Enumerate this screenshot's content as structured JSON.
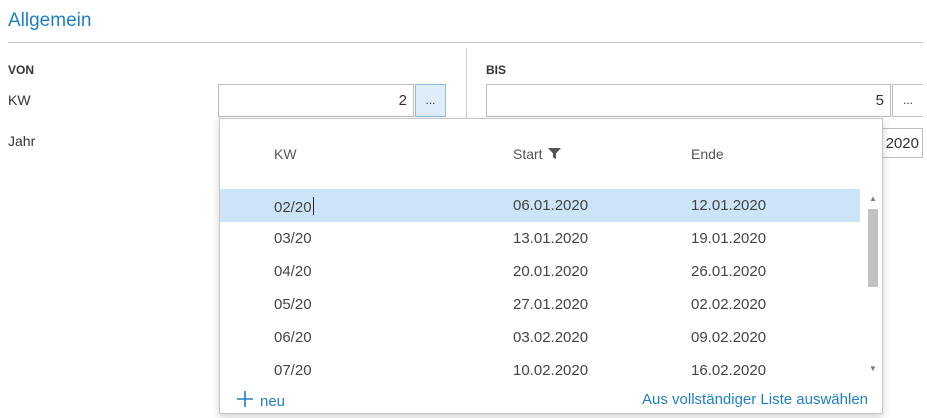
{
  "section": {
    "title": "Allgemein"
  },
  "from": {
    "header": "VON",
    "week_label": "KW",
    "week_value": "2",
    "year_label": "Jahr",
    "lookup_label": "..."
  },
  "to": {
    "header": "BIS",
    "week_value": "5",
    "year_value": "2020",
    "lookup_label": "..."
  },
  "dropdown": {
    "columns": {
      "kw": "KW",
      "start": "Start",
      "end": "Ende"
    },
    "rows": [
      {
        "kw": "02/20",
        "start": "06.01.2020",
        "end": "12.01.2020"
      },
      {
        "kw": "03/20",
        "start": "13.01.2020",
        "end": "19.01.2020"
      },
      {
        "kw": "04/20",
        "start": "20.01.2020",
        "end": "26.01.2020"
      },
      {
        "kw": "05/20",
        "start": "27.01.2020",
        "end": "02.02.2020"
      },
      {
        "kw": "06/20",
        "start": "03.02.2020",
        "end": "09.02.2020"
      },
      {
        "kw": "07/20",
        "start": "10.02.2020",
        "end": "16.02.2020"
      }
    ],
    "new_label": "neu",
    "full_list_label": "Aus vollständiger Liste auswählen"
  }
}
